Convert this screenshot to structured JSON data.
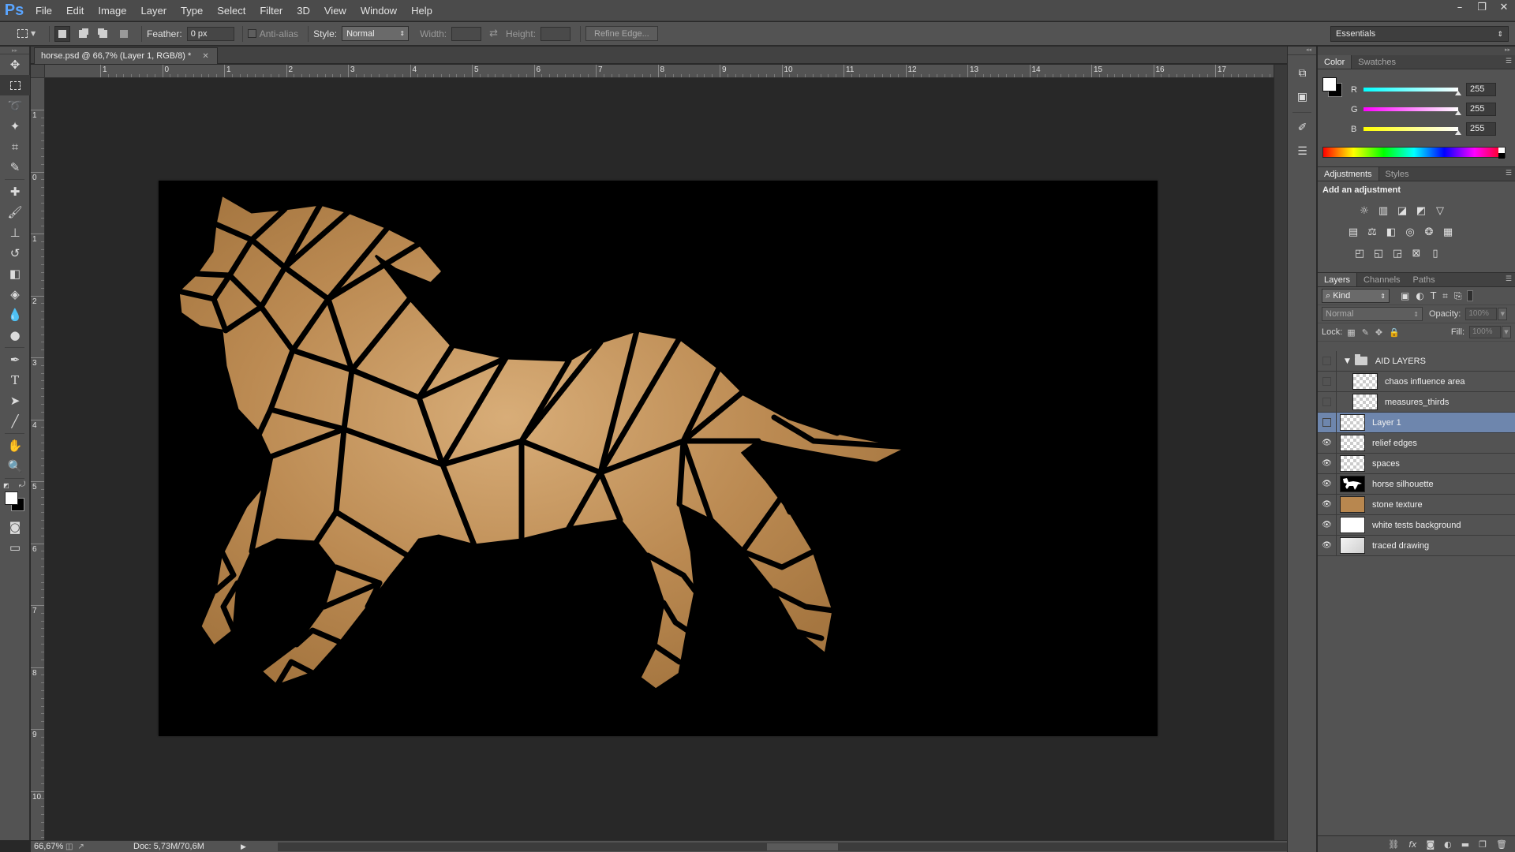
{
  "app": {
    "logo": "Ps",
    "menu": [
      "File",
      "Edit",
      "Image",
      "Layer",
      "Type",
      "Select",
      "Filter",
      "3D",
      "View",
      "Window",
      "Help"
    ],
    "window_controls": [
      "–",
      "❐",
      "✕"
    ]
  },
  "options": {
    "feather_label": "Feather:",
    "feather_value": "0 px",
    "antialias_label": "Anti-alias",
    "style_label": "Style:",
    "style_value": "Normal",
    "width_label": "Width:",
    "height_label": "Height:",
    "refine_edge_label": "Refine Edge...",
    "workspace_value": "Essentials"
  },
  "document": {
    "tab_title": "horse.psd @ 66,7% (Layer 1, RGB/8) *",
    "close_glyph": "✕",
    "colors": {
      "canvas": "#000000",
      "stone": "#b8874f",
      "stone_light": "#d3a872"
    }
  },
  "rulers": {
    "horizontal": [
      "1",
      "0",
      "1",
      "2",
      "3",
      "4",
      "5",
      "6",
      "7",
      "8",
      "9",
      "10",
      "11",
      "12",
      "13",
      "14",
      "15",
      "16",
      "17"
    ],
    "vertical": [
      "1",
      "0",
      "1",
      "2",
      "3",
      "4",
      "5",
      "6",
      "7",
      "8",
      "9",
      "10"
    ]
  },
  "status": {
    "zoom": "66,67%",
    "doc_info": "Doc: 5,73M/70,6M",
    "arrow": "▶"
  },
  "color_panel": {
    "tabs": [
      "Color",
      "Swatches"
    ],
    "channels": [
      {
        "label": "R",
        "value": "255",
        "level": 1.0
      },
      {
        "label": "G",
        "value": "255",
        "level": 1.0
      },
      {
        "label": "B",
        "value": "255",
        "level": 1.0
      }
    ]
  },
  "adjustments_panel": {
    "tabs": [
      "Adjustments",
      "Styles"
    ],
    "title": "Add an adjustment"
  },
  "layers_panel": {
    "tabs": [
      "Layers",
      "Channels",
      "Paths"
    ],
    "kind_value": "Kind",
    "blend_value": "Normal",
    "opacity_label": "Opacity:",
    "opacity_value": "100%",
    "lock_label": "Lock:",
    "fill_label": "Fill:",
    "fill_value": "100%",
    "group": {
      "name": "AID LAYERS"
    },
    "layers": [
      {
        "name": "chaos influence area",
        "visible": false,
        "in_group": true,
        "thumb": "transparent"
      },
      {
        "name": "measures_thirds",
        "visible": false,
        "in_group": true,
        "thumb": "transparent"
      },
      {
        "name": "Layer 1",
        "visible": false,
        "in_group": false,
        "thumb": "transparent",
        "selected": true
      },
      {
        "name": "relief edges",
        "visible": true,
        "in_group": false,
        "thumb": "transparent"
      },
      {
        "name": "spaces",
        "visible": true,
        "in_group": false,
        "thumb": "transparent"
      },
      {
        "name": "horse silhouette",
        "visible": true,
        "in_group": false,
        "thumb": "horse"
      },
      {
        "name": "stone texture",
        "visible": true,
        "in_group": false,
        "thumb": "stone"
      },
      {
        "name": "white tests background",
        "visible": true,
        "in_group": false,
        "thumb": "white"
      },
      {
        "name": "traced drawing",
        "visible": true,
        "in_group": false,
        "thumb": "drawing"
      }
    ]
  }
}
